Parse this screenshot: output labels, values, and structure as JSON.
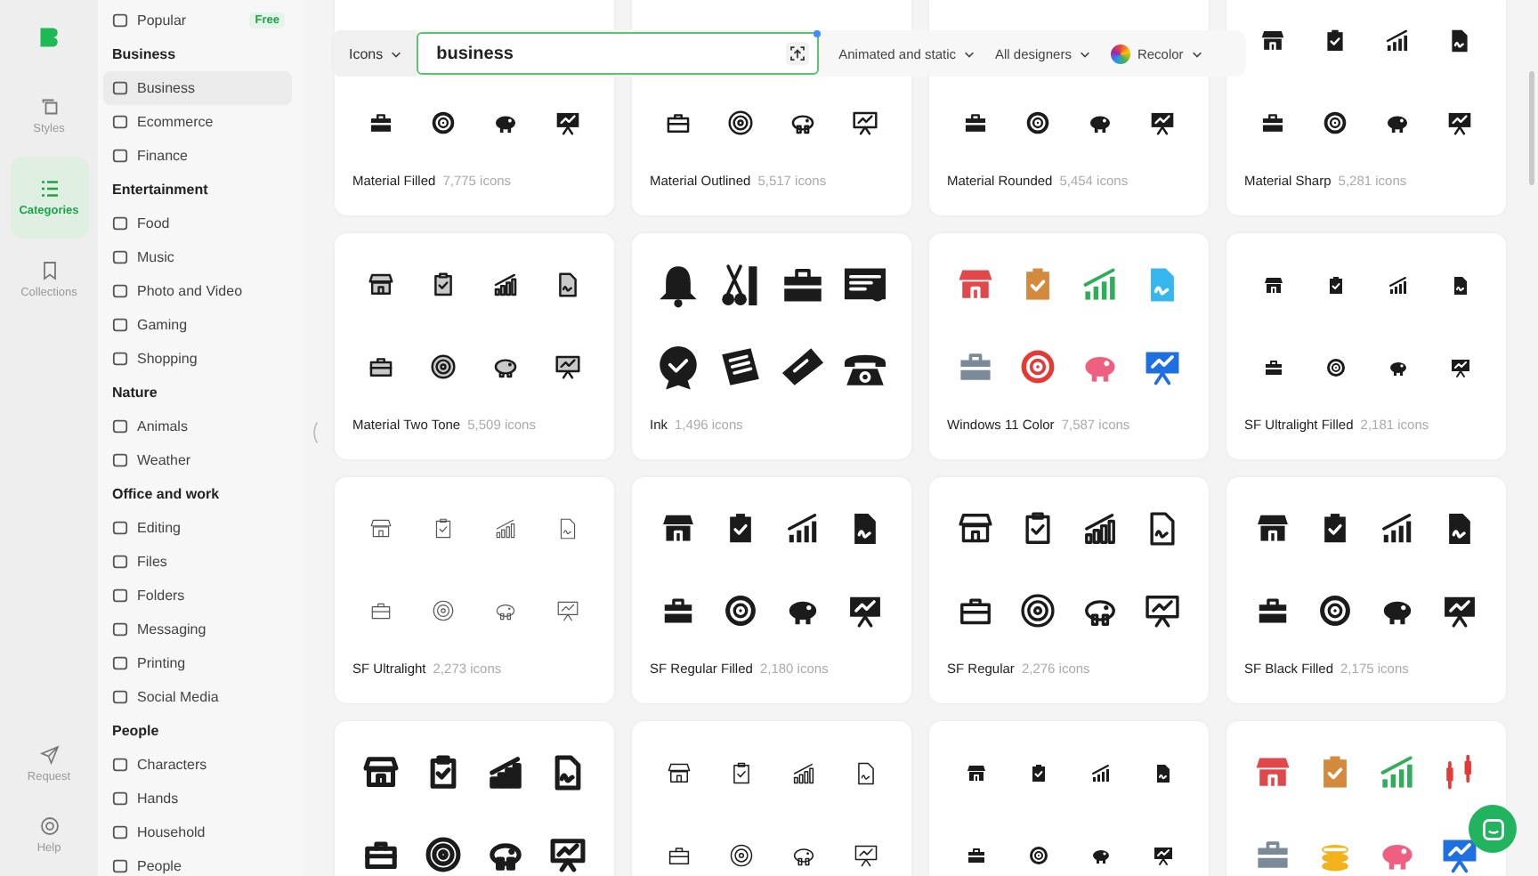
{
  "rail": {
    "items": [
      {
        "label": "Styles",
        "selected": false
      },
      {
        "label": "Categories",
        "selected": true
      },
      {
        "label": "Collections",
        "selected": false
      }
    ],
    "bottom": [
      {
        "label": "Request"
      },
      {
        "label": "Help"
      }
    ]
  },
  "sidebar": {
    "items": [
      {
        "kind": "item",
        "label": "Popular",
        "badge": "Free",
        "selected": false
      },
      {
        "kind": "header",
        "label": "Business"
      },
      {
        "kind": "item",
        "label": "Business",
        "selected": true
      },
      {
        "kind": "item",
        "label": "Ecommerce",
        "selected": false
      },
      {
        "kind": "item",
        "label": "Finance",
        "selected": false
      },
      {
        "kind": "header",
        "label": "Entertainment"
      },
      {
        "kind": "item",
        "label": "Food",
        "selected": false
      },
      {
        "kind": "item",
        "label": "Music",
        "selected": false
      },
      {
        "kind": "item",
        "label": "Photo and Video",
        "selected": false
      },
      {
        "kind": "item",
        "label": "Gaming",
        "selected": false
      },
      {
        "kind": "item",
        "label": "Shopping",
        "selected": false
      },
      {
        "kind": "header",
        "label": "Nature"
      },
      {
        "kind": "item",
        "label": "Animals",
        "selected": false
      },
      {
        "kind": "item",
        "label": "Weather",
        "selected": false
      },
      {
        "kind": "header",
        "label": "Office and work"
      },
      {
        "kind": "item",
        "label": "Editing",
        "selected": false
      },
      {
        "kind": "item",
        "label": "Files",
        "selected": false
      },
      {
        "kind": "item",
        "label": "Folders",
        "selected": false
      },
      {
        "kind": "item",
        "label": "Messaging",
        "selected": false
      },
      {
        "kind": "item",
        "label": "Printing",
        "selected": false
      },
      {
        "kind": "item",
        "label": "Social Media",
        "selected": false
      },
      {
        "kind": "header",
        "label": "People"
      },
      {
        "kind": "item",
        "label": "Characters",
        "selected": false
      },
      {
        "kind": "item",
        "label": "Hands",
        "selected": false
      },
      {
        "kind": "item",
        "label": "Household",
        "selected": false
      },
      {
        "kind": "item",
        "label": "People",
        "selected": false
      }
    ]
  },
  "toolbar": {
    "type_menu": "Icons",
    "search": {
      "value": "business"
    },
    "filters": [
      "Animated and static",
      "All designers"
    ],
    "recolor": "Recolor"
  },
  "cards": [
    {
      "kind": "business",
      "name": "Material Filled",
      "count": "7,775 icons"
    },
    {
      "kind": "business",
      "name": "Material Outlined",
      "count": "5,517 icons"
    },
    {
      "kind": "business",
      "name": "Material Rounded",
      "count": "5,454 icons"
    },
    {
      "kind": "business",
      "name": "Material Sharp",
      "count": "5,281 icons"
    },
    {
      "kind": "business",
      "name": "Material Two Tone",
      "count": "5,509 icons"
    },
    {
      "kind": "ink",
      "name": "Ink",
      "count": "1,496 icons"
    },
    {
      "kind": "business",
      "name": "Windows 11 Color",
      "count": "7,587 icons"
    },
    {
      "kind": "business",
      "name": "SF Ultralight Filled",
      "count": "2,181 icons"
    },
    {
      "kind": "business",
      "name": "SF Ultralight",
      "count": "2,273 icons"
    },
    {
      "kind": "business",
      "name": "SF Regular Filled",
      "count": "2,180 icons"
    },
    {
      "kind": "business",
      "name": "SF Regular",
      "count": "2,276 icons"
    },
    {
      "kind": "business",
      "name": "SF Black Filled",
      "count": "2,175 icons"
    },
    {
      "kind": "business"
    },
    {
      "kind": "business"
    },
    {
      "kind": "business"
    },
    {
      "kind": "finance"
    }
  ]
}
